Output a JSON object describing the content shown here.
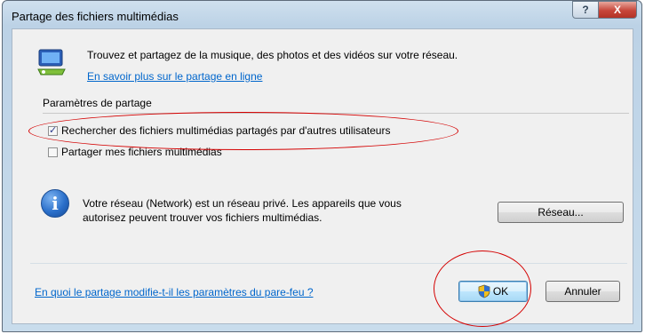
{
  "window": {
    "title": "Partage des fichiers multimédias",
    "help_label": "?",
    "close_label": "X"
  },
  "intro": {
    "icon": "network-media-icon",
    "text": "Trouvez et partagez de la musique, des photos et des vidéos sur votre réseau.",
    "learn_more_link": "En savoir plus sur le partage en ligne"
  },
  "sharing_settings": {
    "group_label": "Paramètres de partage",
    "options": [
      {
        "label": "Rechercher des fichiers multimédias partagés par d'autres utilisateurs",
        "checked": true
      },
      {
        "label": "Partager mes fichiers multimédias",
        "checked": false
      }
    ]
  },
  "network_info": {
    "icon": "info-icon",
    "icon_glyph": "i",
    "line1": "Votre réseau (Network) est un réseau privé. Les appareils que vous",
    "line2": "autorisez peuvent trouver vos fichiers multimédias.",
    "network_button": "Réseau..."
  },
  "footer": {
    "firewall_link": "En quoi le partage modifie-t-il les paramètres du pare-feu ?",
    "ok_button": "OK",
    "cancel_button": "Annuler"
  },
  "colors": {
    "link": "#0066cc",
    "annotation": "#d40000",
    "title_bar": "#bcd2e6",
    "client_background": "#f0f0f0"
  }
}
